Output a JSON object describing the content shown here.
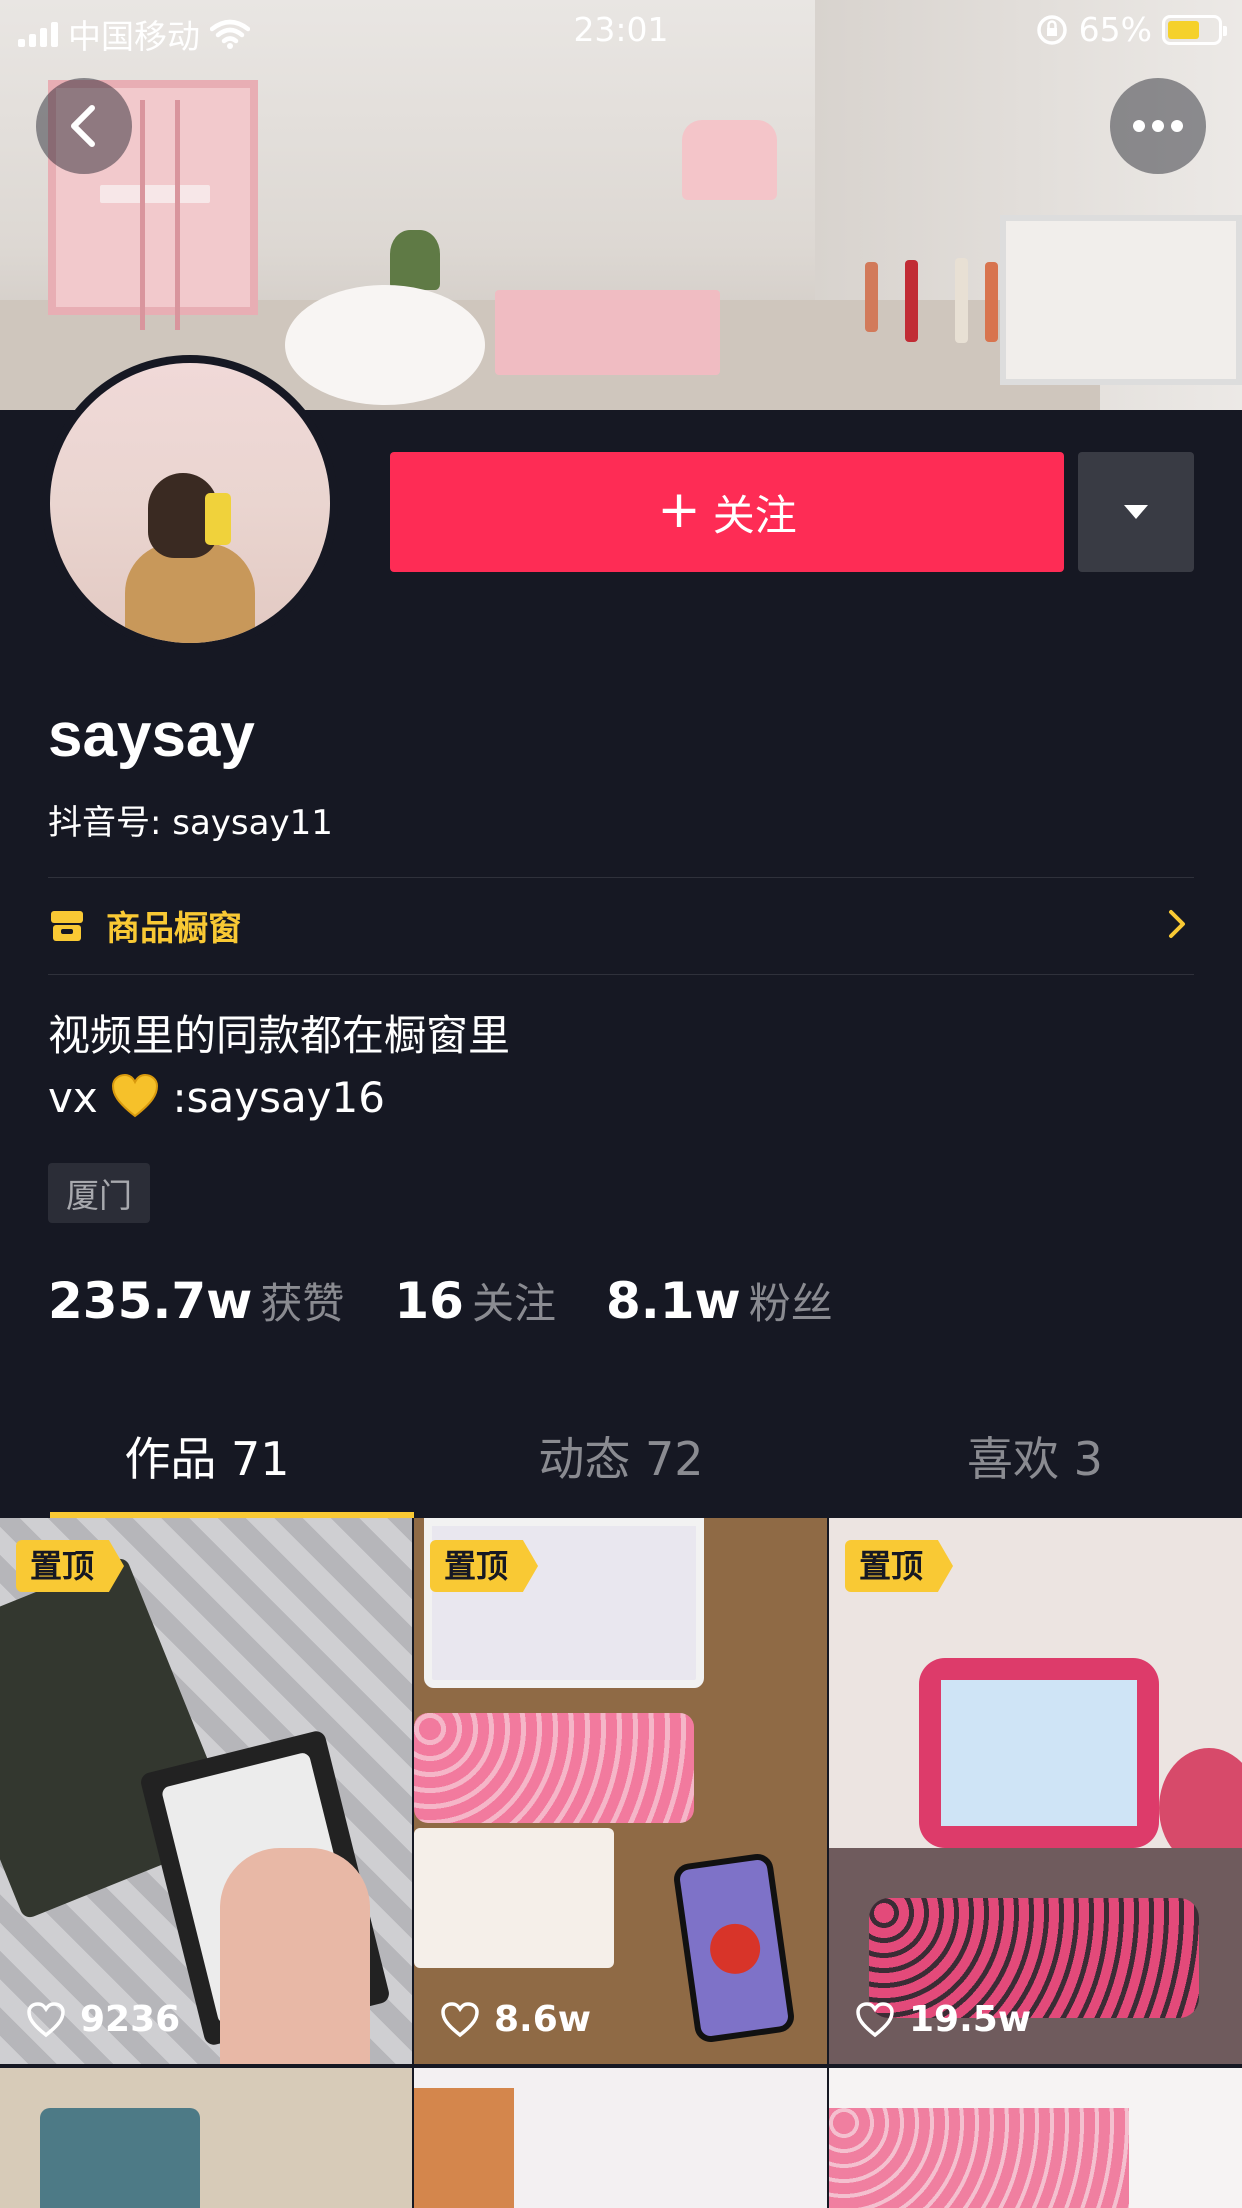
{
  "status_bar": {
    "carrier": "中国移动",
    "time": "23:01",
    "battery": "65%",
    "battery_level": 0.65
  },
  "header": {
    "back_icon": "chevron-left-icon",
    "more_icon": "more-dots-icon"
  },
  "profile": {
    "name": "saysay",
    "douyin_id": "抖音号: saysay11",
    "follow_label": "关注",
    "shop_label": "商品橱窗",
    "bio_line1": "视频里的同款都在橱窗里",
    "bio_line2_prefix": "vx",
    "bio_line2_suffix": ":saysay16",
    "location_tag": "厦门"
  },
  "stats": [
    {
      "value": "235.7w",
      "label": "获赞"
    },
    {
      "value": "16",
      "label": "关注"
    },
    {
      "value": "8.1w",
      "label": "粉丝"
    }
  ],
  "tabs": [
    {
      "label": "作品 71",
      "active": true
    },
    {
      "label": "动态 72",
      "active": false
    },
    {
      "label": "喜欢 3",
      "active": false
    }
  ],
  "videos": [
    {
      "pinned": "置顶",
      "likes": "9236"
    },
    {
      "pinned": "置顶",
      "likes": "8.6w"
    },
    {
      "pinned": "置顶",
      "likes": "19.5w"
    }
  ],
  "colors": {
    "background": "#161823",
    "follow": "#fe2c55",
    "accent": "#f9c934",
    "muted": "#8a8b91"
  }
}
